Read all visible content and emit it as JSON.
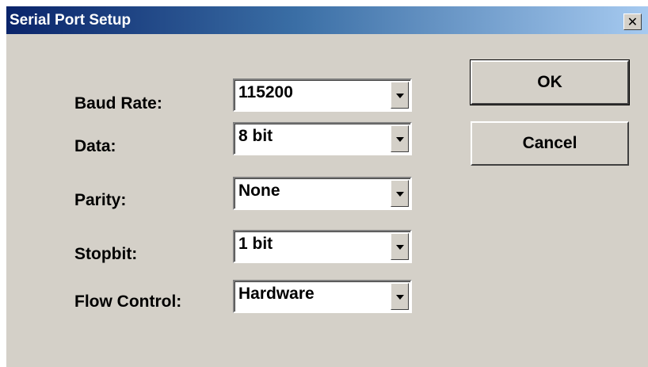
{
  "window": {
    "title": "Serial Port Setup",
    "close_glyph": "✕",
    "close_icon": "close-icon"
  },
  "fields": {
    "baud_rate": {
      "label": "Baud Rate:",
      "value": "115200"
    },
    "data": {
      "label": "Data:",
      "value": "8 bit"
    },
    "parity": {
      "label": "Parity:",
      "value": "None"
    },
    "stopbit": {
      "label": "Stopbit:",
      "value": "1 bit"
    },
    "flow_control": {
      "label": "Flow Control:",
      "value": "Hardware"
    }
  },
  "buttons": {
    "ok": "OK",
    "cancel": "Cancel"
  },
  "colors": {
    "dialog_face": "#d4d0c8",
    "title_start": "#0a246a",
    "title_end": "#a6caf0"
  }
}
